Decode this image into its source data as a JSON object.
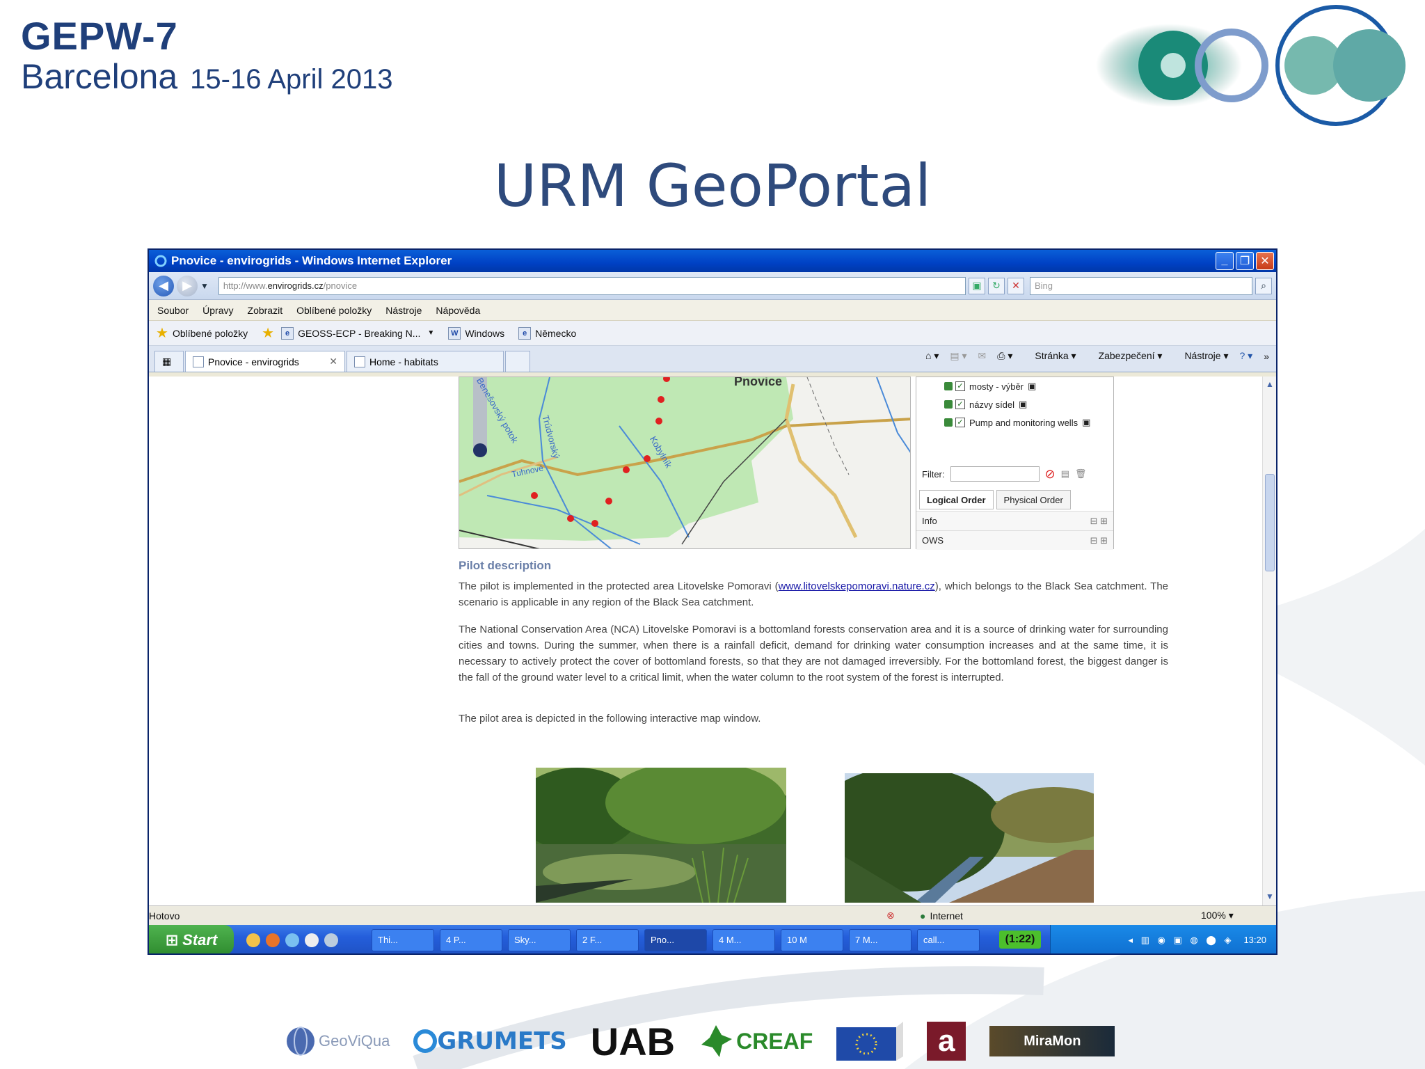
{
  "slide": {
    "conference_name": "GEPW-7",
    "conference_city": "Barcelona",
    "conference_dates": "15-16 April 2013",
    "heading": "URM GeoPortal"
  },
  "browser": {
    "window_title": "Pnovice - envirogrids - Windows Internet Explorer",
    "url_prefix": "http://www.",
    "url_host": "envirogrids.cz",
    "url_path": "/pnovice",
    "search_placeholder": "Bing",
    "menu": [
      "Soubor",
      "Úpravy",
      "Zobrazit",
      "Oblíbené položky",
      "Nástroje",
      "Nápověda"
    ],
    "favorites": {
      "label": "Oblíbené položky",
      "items": [
        "GEOSS-ECP - Breaking N...",
        "Windows",
        "Německo"
      ]
    },
    "tabs": [
      {
        "label": "Pnovice - envirogrids",
        "active": true
      },
      {
        "label": "Home - habitats",
        "active": false
      }
    ],
    "command_bar": [
      "Stránka",
      "Zabezpečení",
      "Nástroje"
    ],
    "status_text": "Hotovo",
    "zone_text": "Internet",
    "zoom_text": "100%"
  },
  "map": {
    "place_label": "Pnovice",
    "river_labels": [
      "Benešovský potok",
      "Trúdvorský",
      "Kobylník",
      "Tuhnové"
    ],
    "layers": [
      {
        "label": "mosty - výběr",
        "checked": true
      },
      {
        "label": "názvy sídel",
        "checked": true
      },
      {
        "label": "Pump and monitoring wells",
        "checked": true
      }
    ],
    "filter_label": "Filter:",
    "order_tabs": [
      "Logical Order",
      "Physical Order"
    ],
    "panel_rows": [
      "Info",
      "OWS"
    ]
  },
  "pilot": {
    "heading": "Pilot description",
    "p1_before": "The pilot is implemented in the protected area Litovelske Pomoravi (",
    "p1_link": "www.litovelskepomoravi.nature.cz",
    "p1_after": "), which belongs to the Black Sea catchment. The scenario is applicable in any region of the Black Sea catchment.",
    "p2": "The National Conservation Area (NCA) Litovelske Pomoravi is a bottomland forests conservation area and it is a source of drinking water for surrounding cities and towns. During the summer, when there is a rainfall deficit, demand for drinking water consumption increases and at the same time, it is necessary to actively protect the cover of bottomland forests, so that they are not damaged irreversibly.  For the bottomland forest, the biggest danger is the fall of the ground water level to a critical limit, when the water column to the root system of the forest is interrupted.",
    "p3": "The pilot area is depicted in the following interactive map window."
  },
  "taskbar": {
    "start_label": "Start",
    "tasks": [
      "Thi...",
      "4 P...",
      "Sky...",
      "2 F...",
      "Pno...",
      "4 M...",
      "10 M",
      "7 M...",
      "call..."
    ],
    "counter": "(1:22)",
    "clock": "13:20"
  },
  "sponsors": [
    "GeoViQua",
    "GRUMETS",
    "UAB",
    "CREAF",
    "",
    "a",
    "MiraMon"
  ],
  "colors": {
    "title_blue": "#1f3f7a",
    "heading_blue": "#2e4a7c",
    "xp_blue": "#245edb",
    "start_green": "#2f8c2f",
    "link": "#1a1aa8"
  }
}
